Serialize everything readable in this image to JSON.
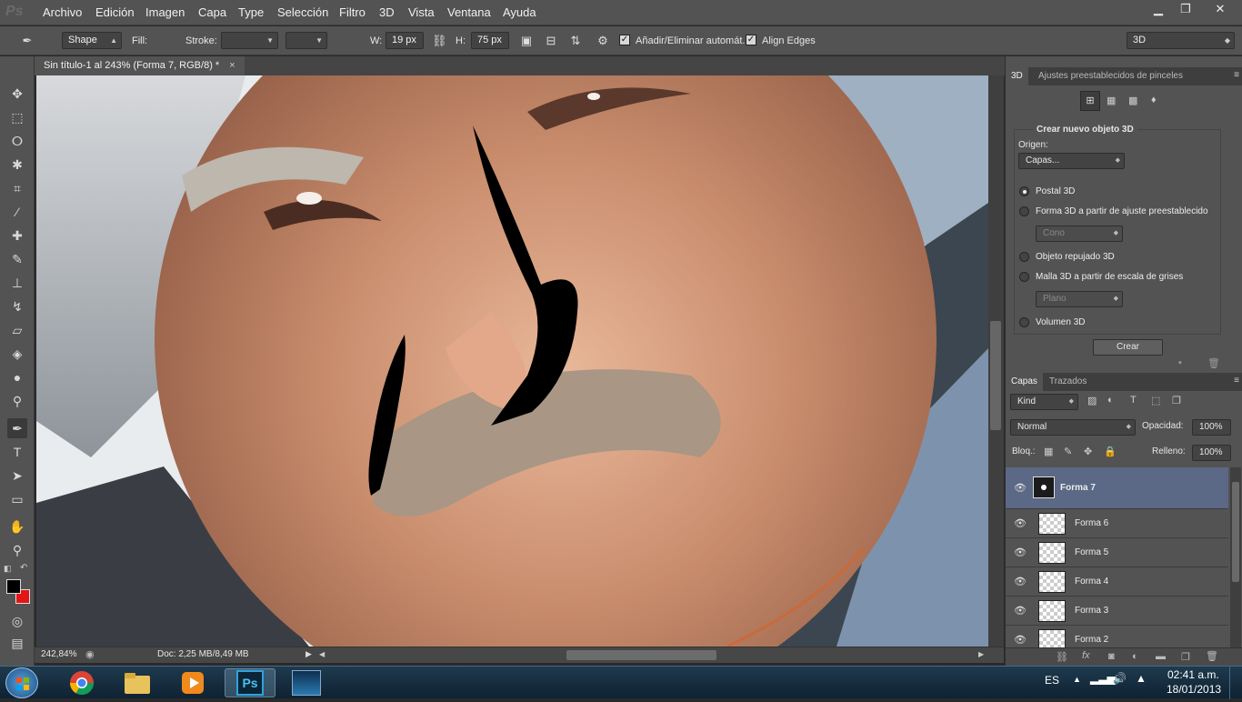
{
  "app": {
    "logo": "Ps"
  },
  "menu": [
    "Archivo",
    "Edición",
    "Imagen",
    "Capa",
    "Type",
    "Selección",
    "Filtro",
    "3D",
    "Vista",
    "Ventana",
    "Ayuda"
  ],
  "window_controls": {
    "minimize": "▁",
    "restore": "❐",
    "close": "✕"
  },
  "options": {
    "tool_mode": "Shape",
    "fill_label": "Fill:",
    "stroke_label": "Stroke:",
    "width_label": "W:",
    "width_value": "19 px",
    "height_label": "H:",
    "height_value": "75 px",
    "auto_add_delete": "Añadir/Eliminar automát.",
    "align_edges": "Align Edges",
    "workspace": "3D",
    "fill_color": "#000000"
  },
  "document": {
    "tab_title": "Sin título-1 al 243% (Forma 7, RGB/8) *",
    "close": "×",
    "zoom": "242,84%",
    "doc_info": "Doc: 2,25 MB/8,49 MB"
  },
  "panel3d": {
    "tabs": [
      "3D",
      "Ajustes preestablecidos de pinceles"
    ],
    "section_title": "Crear nuevo objeto 3D",
    "origin_label": "Origen:",
    "origin_value": "Capas...",
    "options": [
      {
        "label": "Postal 3D",
        "selected": true
      },
      {
        "label": "Forma 3D a partir de ajuste preestablecido",
        "selected": false
      },
      {
        "label": "Objeto repujado 3D",
        "selected": false
      },
      {
        "label": "Malla 3D a partir de escala de grises",
        "selected": false
      },
      {
        "label": "Volumen 3D",
        "selected": false
      }
    ],
    "preset_value": "Cono",
    "mesh_value": "Plano",
    "create_button": "Crear"
  },
  "layers_panel": {
    "tabs": [
      "Capas",
      "Trazados"
    ],
    "filter_kind": "Kind",
    "blend_mode": "Normal",
    "opacity_label": "Opacidad:",
    "opacity_value": "100%",
    "lock_label": "Bloq.:",
    "fill_label": "Relleno:",
    "fill_value": "100%",
    "layers": [
      {
        "name": "Forma 7",
        "selected": true
      },
      {
        "name": "Forma 6",
        "selected": false
      },
      {
        "name": "Forma 5",
        "selected": false
      },
      {
        "name": "Forma 4",
        "selected": false
      },
      {
        "name": "Forma 3",
        "selected": false
      },
      {
        "name": "Forma 2",
        "selected": false
      }
    ]
  },
  "taskbar": {
    "language": "ES",
    "time": "02:41 a.m.",
    "date": "18/01/2013"
  },
  "colors": {
    "foreground": "#000000",
    "background": "#e31515",
    "selected_layer": "#5b6886",
    "ui_gray": "#535353"
  }
}
